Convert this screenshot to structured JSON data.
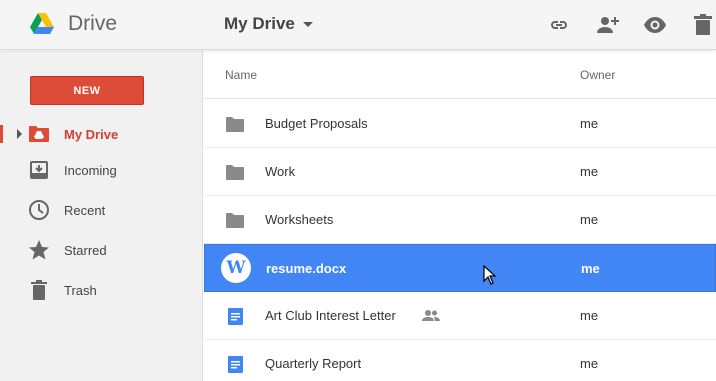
{
  "header": {
    "app_name": "Drive",
    "location": "My Drive",
    "actions": [
      {
        "icon": "link-icon"
      },
      {
        "icon": "add-person-icon"
      },
      {
        "icon": "preview-eye-icon"
      },
      {
        "icon": "trash-icon"
      }
    ]
  },
  "sidebar": {
    "new_label": "NEW",
    "items": [
      {
        "label": "My Drive",
        "icon": "drive-folder-icon",
        "active": true
      },
      {
        "label": "Incoming",
        "icon": "inbox-icon",
        "active": false
      },
      {
        "label": "Recent",
        "icon": "clock-icon",
        "active": false
      },
      {
        "label": "Starred",
        "icon": "star-icon",
        "active": false
      },
      {
        "label": "Trash",
        "icon": "trash-icon",
        "active": false
      }
    ]
  },
  "list": {
    "columns": {
      "name": "Name",
      "owner": "Owner"
    },
    "rows": [
      {
        "name": "Budget Proposals",
        "owner": "me",
        "type": "folder",
        "icon": "folder-icon"
      },
      {
        "name": "Work",
        "owner": "me",
        "type": "folder",
        "icon": "folder-icon"
      },
      {
        "name": "Worksheets",
        "owner": "me",
        "type": "folder",
        "icon": "folder-icon"
      },
      {
        "name": "resume.docx",
        "owner": "me",
        "type": "word",
        "icon": "word-doc-icon",
        "badge": "W",
        "selected": true
      },
      {
        "name": "Art Club Interest Letter",
        "owner": "me",
        "type": "doc",
        "icon": "google-doc-icon",
        "shared": true
      },
      {
        "name": "Quarterly Report",
        "owner": "me",
        "type": "doc",
        "icon": "google-doc-icon"
      }
    ]
  },
  "colors": {
    "accent_red": "#dd4b39",
    "selection_blue": "#4285f4",
    "doc_blue": "#4285f4",
    "folder_gray": "#8a8a8a"
  }
}
